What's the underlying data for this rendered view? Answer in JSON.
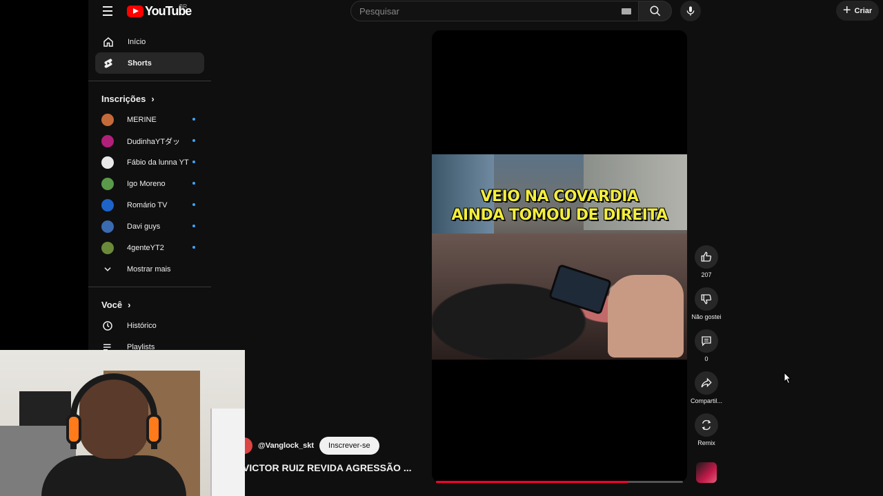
{
  "header": {
    "logo_text": "YouTube",
    "country_code": "BR",
    "search_placeholder": "Pesquisar",
    "create_label": "Criar"
  },
  "sidebar": {
    "main": [
      {
        "label": "Início",
        "icon": "home-icon"
      },
      {
        "label": "Shorts",
        "icon": "shorts-icon",
        "active": true
      }
    ],
    "subscriptions_title": "Inscrições",
    "subscriptions": [
      {
        "label": "MERINE",
        "color": "#c46a3a"
      },
      {
        "label": "DudinhaYTダッ",
        "color": "#b0207a"
      },
      {
        "label": "Fábio da lunna YT",
        "color": "#e9e9e9"
      },
      {
        "label": "Igo Moreno",
        "color": "#5a9a4a"
      },
      {
        "label": "Romário TV",
        "color": "#1e64c8"
      },
      {
        "label": "Davi guys",
        "color": "#3a6ab0"
      },
      {
        "label": "4genteYT2",
        "color": "#6a8a3a"
      }
    ],
    "show_more": "Mostrar mais",
    "you_title": "Você",
    "you_items": [
      {
        "label": "Histórico",
        "icon": "history-icon"
      },
      {
        "label": "Playlists",
        "icon": "playlists-icon"
      }
    ]
  },
  "short": {
    "caption_line1": "VEIO NA COVARDIA",
    "caption_line2": "AINDA TOMOU DE DIREITA",
    "channel": "@Vanglock_skt",
    "subscribe_label": "Inscrever-se",
    "title": "VICTOR RUIZ REVIDA AGRESSÃO ...",
    "progress_fraction": 0.78
  },
  "actions": {
    "like_count": "207",
    "dislike_label": "Não gostei",
    "comment_count": "0",
    "share_label": "Compartil...",
    "remix_label": "Remix"
  },
  "colors": {
    "accent": "#ff0033",
    "dot": "#3ea6ff",
    "caption": "#f3ee3d"
  }
}
